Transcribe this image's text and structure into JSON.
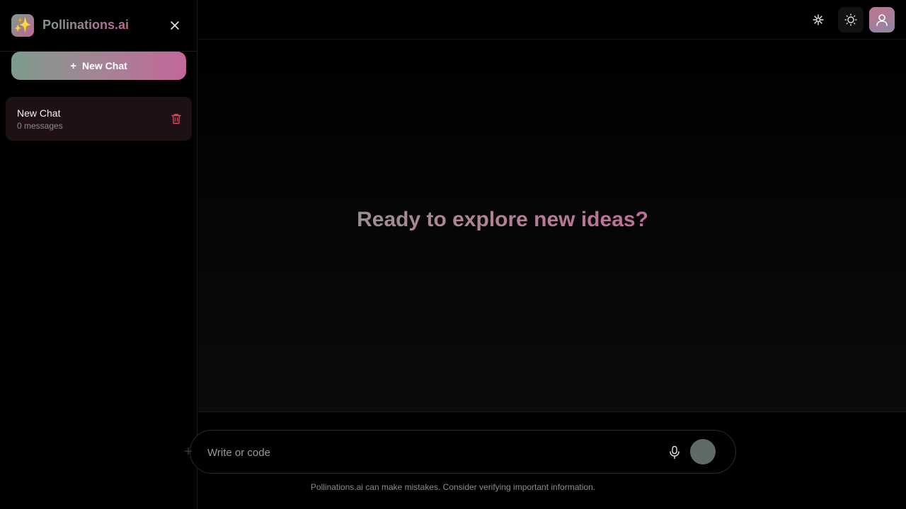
{
  "sidebar": {
    "logo_emoji": "✨",
    "brand": "Pollinations.ai",
    "new_chat_label": "New Chat",
    "chats": [
      {
        "title": "New Chat",
        "subtitle": "0 messages"
      }
    ]
  },
  "main": {
    "welcome": "Ready to explore new ideas?",
    "input_placeholder": "Write or code",
    "disclaimer": "Pollinations.ai can make mistakes. Consider verifying important information."
  },
  "colors": {
    "accent_start": "#7e9c8d",
    "accent_end": "#c4679a",
    "delete": "#e0475a"
  },
  "icons": {
    "close": "close-icon",
    "plus": "plus-icon",
    "delete": "trash-icon",
    "spark": "sparkle-icon",
    "theme": "sun-icon",
    "avatar": "user-icon",
    "mic": "microphone-icon",
    "attach": "plus-icon"
  }
}
